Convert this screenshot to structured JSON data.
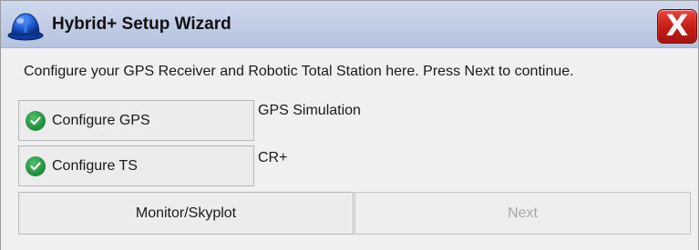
{
  "window": {
    "title": "Hybrid+ Setup Wizard",
    "app_icon": "hard-hat-icon",
    "close_icon": "close-icon",
    "close_label": "X"
  },
  "main": {
    "instruction": "Configure your GPS Receiver and Robotic Total Station here. Press Next to continue.",
    "gps": {
      "button_label": "Configure GPS",
      "status_icon": "check-circle-icon",
      "value": "GPS Simulation"
    },
    "ts": {
      "button_label": "Configure TS",
      "status_icon": "check-circle-icon",
      "value": "CR+"
    },
    "footer": {
      "monitor_label": "Monitor/Skyplot",
      "next_label": "Next",
      "next_enabled": false
    }
  },
  "colors": {
    "title_bar": "#b4c3df",
    "close_button": "#c41c15",
    "check": "#23923f",
    "disabled_text": "#a7a7a7"
  }
}
